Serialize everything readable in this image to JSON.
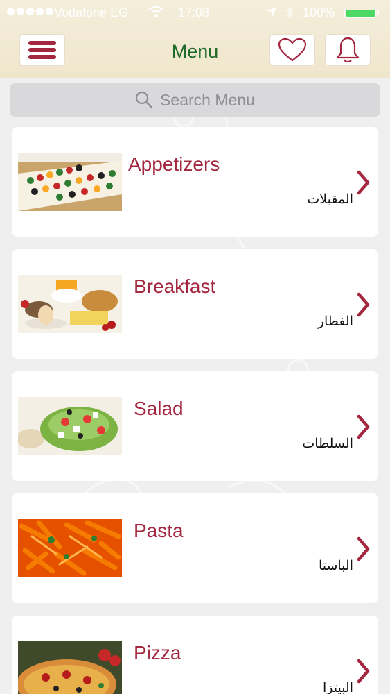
{
  "status_bar": {
    "carrier": "Vodafone EG",
    "time": "17:08",
    "battery": "100%"
  },
  "header": {
    "title": "Menu"
  },
  "search": {
    "placeholder": "Search Menu"
  },
  "colors": {
    "accent": "#a3273f",
    "title_green": "#1f6b2a",
    "header_bg": "#f1e9d2"
  },
  "categories": [
    {
      "name": "Appetizers",
      "name_ar": "المقبلات"
    },
    {
      "name": "Breakfast",
      "name_ar": "الفطار"
    },
    {
      "name": "Salad",
      "name_ar": "السلطات"
    },
    {
      "name": "Pasta",
      "name_ar": "الباستا"
    },
    {
      "name": "Pizza",
      "name_ar": "البيتزا"
    }
  ]
}
